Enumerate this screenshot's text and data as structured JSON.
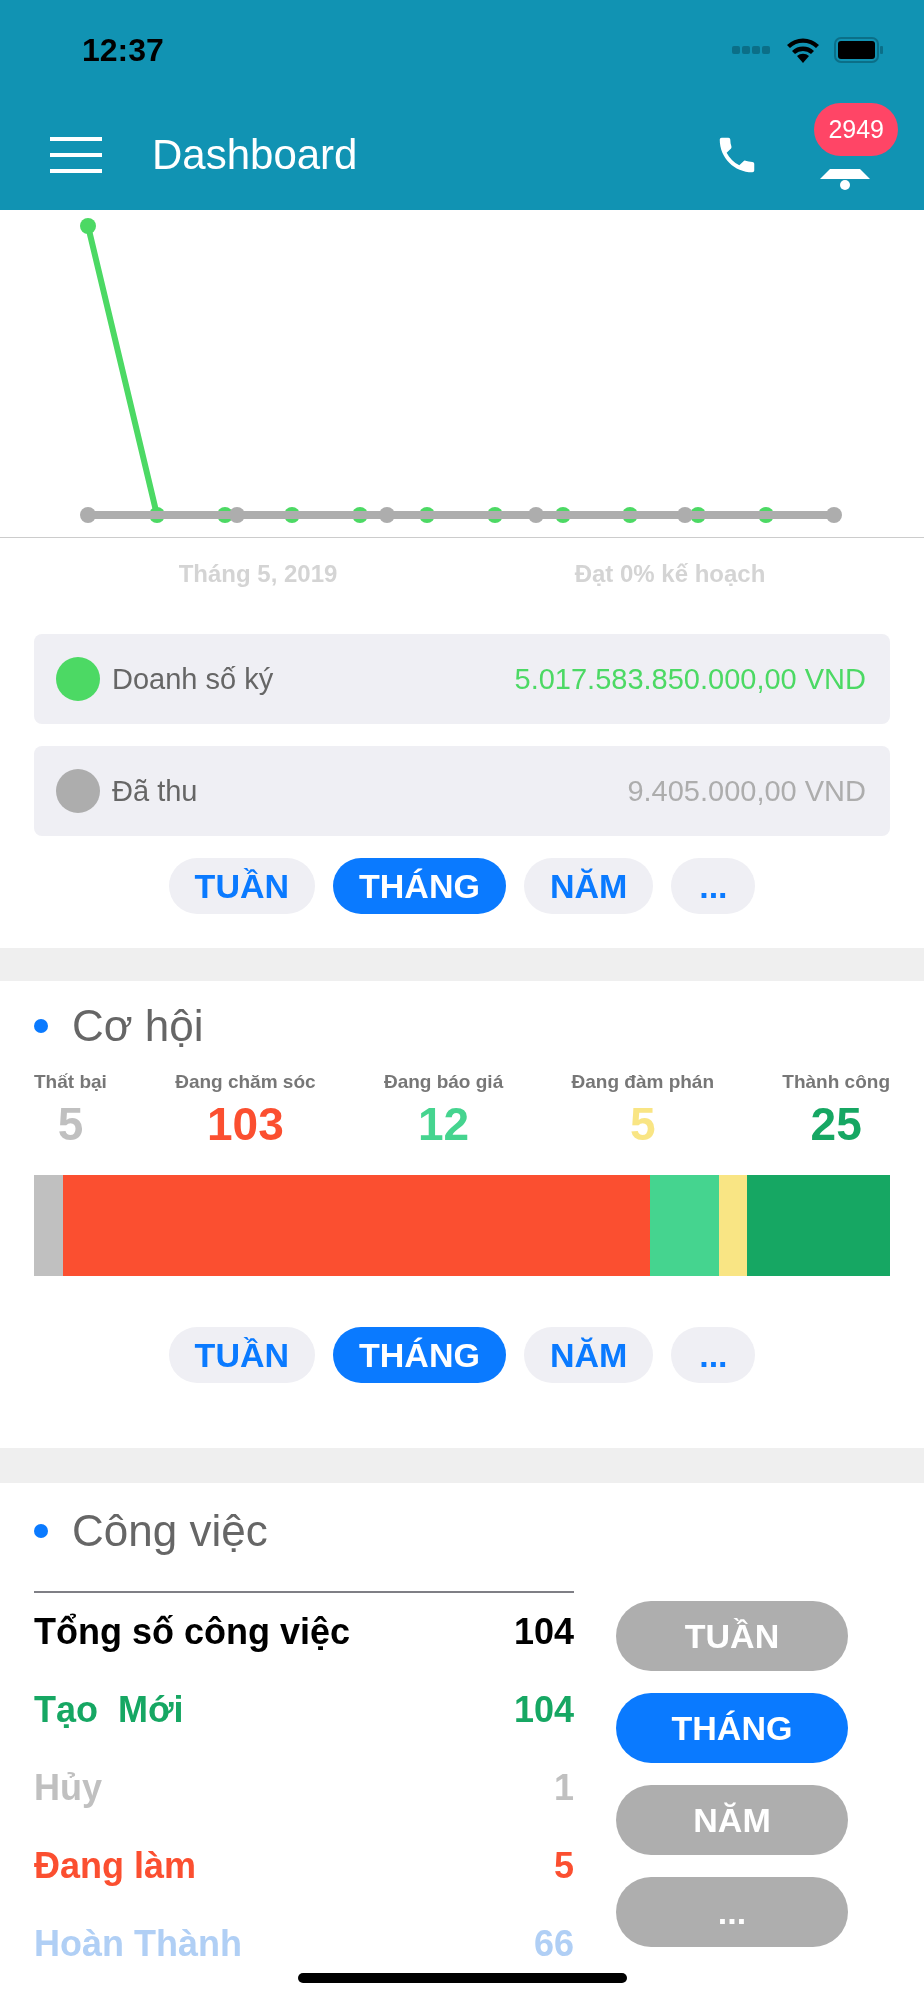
{
  "status_bar": {
    "time": "12:37"
  },
  "header": {
    "title": "Dashboard",
    "badge": "2949"
  },
  "sales": {
    "captions": [
      "Tháng 5, 2019",
      "Đạt 0% kế hoạch"
    ],
    "legend": [
      {
        "label": "Doanh số ký",
        "value": "5.017.583.850.000,00 VND",
        "color": "#4cd964"
      },
      {
        "label": "Đã thu",
        "value": "9.405.000,00 VND",
        "color": "#adadad"
      }
    ],
    "periods": [
      {
        "label": "TUẦN",
        "selected": false
      },
      {
        "label": "THÁNG",
        "selected": true
      },
      {
        "label": "NĂM",
        "selected": false
      },
      {
        "label": "...",
        "selected": false
      }
    ]
  },
  "opportunities": {
    "title": "Cơ hội",
    "stages": [
      {
        "label": "Thất bại",
        "value": "5",
        "color": "#c0c0c0"
      },
      {
        "label": "Đang chăm sóc",
        "value": "103",
        "color": "#fb4f30"
      },
      {
        "label": "Đang báo giá",
        "value": "12",
        "color": "#45d48f"
      },
      {
        "label": "Đang đàm phán",
        "value": "5",
        "color": "#f9e584"
      },
      {
        "label": "Thành công",
        "value": "25",
        "color": "#16a763"
      }
    ],
    "periods": [
      {
        "label": "TUẦN",
        "selected": false
      },
      {
        "label": "THÁNG",
        "selected": true
      },
      {
        "label": "NĂM",
        "selected": false
      },
      {
        "label": "...",
        "selected": false
      }
    ]
  },
  "tasks": {
    "title": "Công việc",
    "rows": [
      {
        "label": "Tổng số công việc",
        "value": "104",
        "color": "#000000"
      },
      {
        "label": "Tạo  Mới",
        "value": "104",
        "color": "#16a763"
      },
      {
        "label": "Hủy",
        "value": "1",
        "color": "#c0c0c0"
      },
      {
        "label": "Đang làm",
        "value": "5",
        "color": "#fb4f30"
      },
      {
        "label": "Hoàn Thành",
        "value": "66",
        "color": "#b0cff5"
      }
    ],
    "periods": [
      {
        "label": "TUẦN",
        "selected": false
      },
      {
        "label": "THÁNG",
        "selected": true
      },
      {
        "label": "NĂM",
        "selected": false
      },
      {
        "label": "...",
        "selected": false
      }
    ]
  }
}
